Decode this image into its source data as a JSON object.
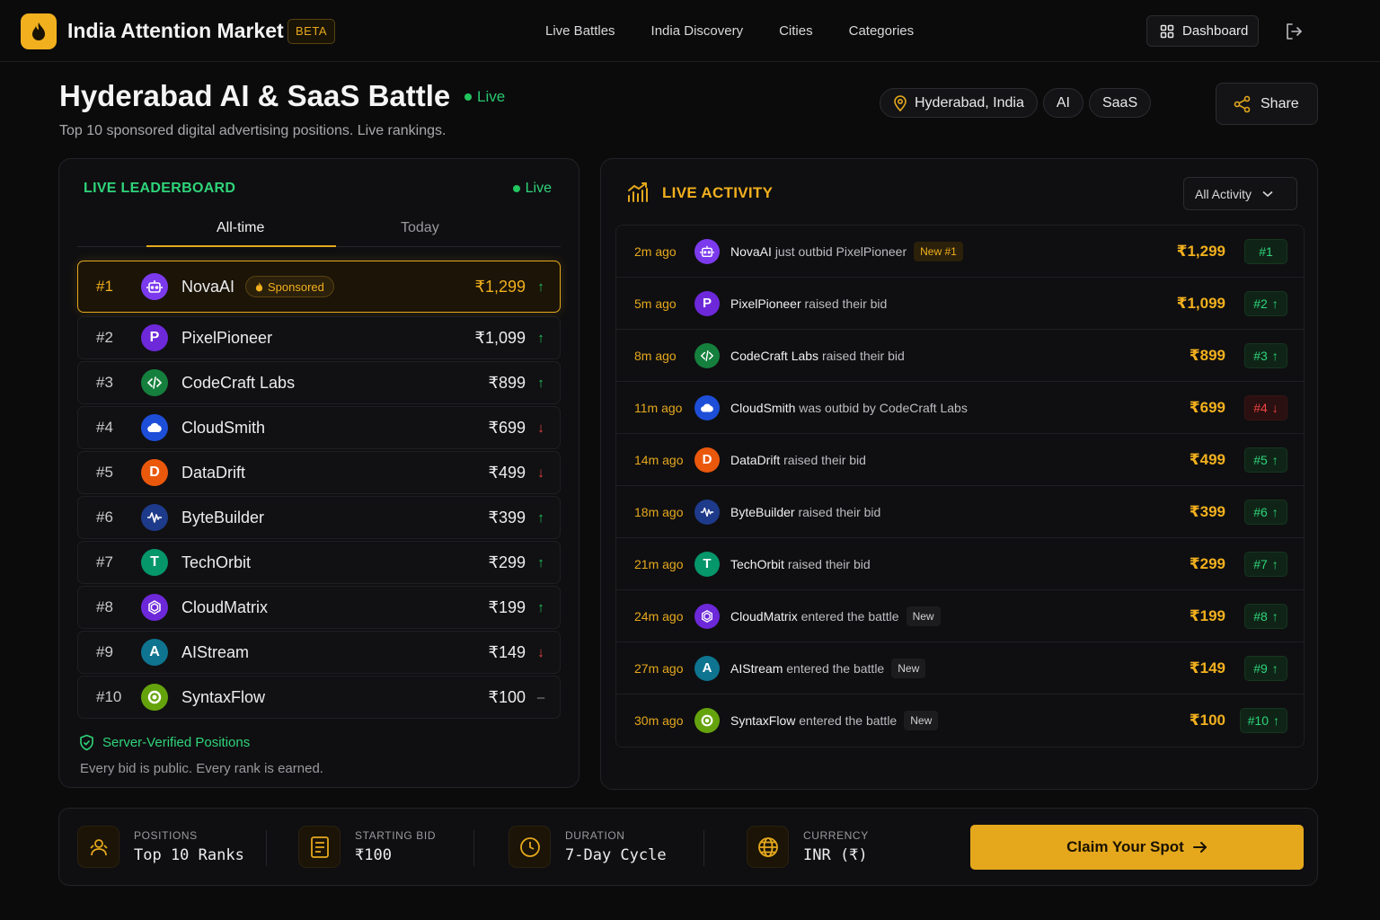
{
  "nav": {
    "brand": "India Attention Market",
    "beta_badge": "BETA",
    "links": [
      "Live Battles",
      "India Discovery",
      "Cities",
      "Categories"
    ],
    "dashboard_label": "Dashboard"
  },
  "header": {
    "title": "Hyderabad AI & SaaS Battle",
    "live_label": "Live",
    "subtitle": "Top 10 sponsored digital advertising positions. Live rankings.",
    "tags": [
      "Hyderabad, India",
      "AI",
      "SaaS"
    ],
    "share_label": "Share"
  },
  "leaderboard": {
    "title": "LIVE LEADERBOARD",
    "live_label": "Live",
    "tabs": [
      "All-time",
      "Today"
    ],
    "sponsored_label": "Sponsored",
    "rows": [
      {
        "rank": "#1",
        "name": "NovaAI",
        "bid": "₹1,299",
        "trend": "up",
        "initial": "",
        "color": "#7c3aed"
      },
      {
        "rank": "#2",
        "name": "PixelPioneer",
        "bid": "₹1,099",
        "trend": "up",
        "initial": "P",
        "color": "#6d28d9"
      },
      {
        "rank": "#3",
        "name": "CodeCraft Labs",
        "bid": "₹899",
        "trend": "up",
        "initial": "",
        "color": "#15803d"
      },
      {
        "rank": "#4",
        "name": "CloudSmith",
        "bid": "₹699",
        "trend": "down",
        "initial": "",
        "color": "#1d4ed8"
      },
      {
        "rank": "#5",
        "name": "DataDrift",
        "bid": "₹499",
        "trend": "down",
        "initial": "D",
        "color": "#ea580c"
      },
      {
        "rank": "#6",
        "name": "ByteBuilder",
        "bid": "₹399",
        "trend": "up",
        "initial": "",
        "color": "#1e3a8a"
      },
      {
        "rank": "#7",
        "name": "TechOrbit",
        "bid": "₹299",
        "trend": "up",
        "initial": "T",
        "color": "#059669"
      },
      {
        "rank": "#8",
        "name": "CloudMatrix",
        "bid": "₹199",
        "trend": "up",
        "initial": "",
        "color": "#6d28d9"
      },
      {
        "rank": "#9",
        "name": "AIStream",
        "bid": "₹149",
        "trend": "down",
        "initial": "A",
        "color": "#0e7490"
      },
      {
        "rank": "#10",
        "name": "SyntaxFlow",
        "bid": "₹100",
        "trend": "flat",
        "initial": "",
        "color": "#65a30d"
      }
    ],
    "verified_label": "Server-Verified Positions",
    "footnote": "Every bid is public. Every rank is earned."
  },
  "activity": {
    "title": "LIVE ACTIVITY",
    "filter_label": "All Activity",
    "rows": [
      {
        "time": "2m ago",
        "name": "NovaAI",
        "text": "just outbid PixelPioneer",
        "badge": "New #1",
        "badge_type": "new1",
        "amount": "₹1,299",
        "rank": "#1",
        "dir": "none",
        "color": "#7c3aed",
        "initial": ""
      },
      {
        "time": "5m ago",
        "name": "PixelPioneer",
        "text": "raised their bid",
        "badge": "",
        "badge_type": "",
        "amount": "₹1,099",
        "rank": "#2",
        "dir": "up",
        "color": "#6d28d9",
        "initial": "P"
      },
      {
        "time": "8m ago",
        "name": "CodeCraft Labs",
        "text": "raised their bid",
        "badge": "",
        "badge_type": "",
        "amount": "₹899",
        "rank": "#3",
        "dir": "up",
        "color": "#15803d",
        "initial": ""
      },
      {
        "time": "11m ago",
        "name": "CloudSmith",
        "text": "was outbid by CodeCraft Labs",
        "badge": "",
        "badge_type": "",
        "amount": "₹699",
        "rank": "#4",
        "dir": "down",
        "color": "#1d4ed8",
        "initial": ""
      },
      {
        "time": "14m ago",
        "name": "DataDrift",
        "text": "raised their bid",
        "badge": "",
        "badge_type": "",
        "amount": "₹499",
        "rank": "#5",
        "dir": "up",
        "color": "#ea580c",
        "initial": "D"
      },
      {
        "time": "18m ago",
        "name": "ByteBuilder",
        "text": "raised their bid",
        "badge": "",
        "badge_type": "",
        "amount": "₹399",
        "rank": "#6",
        "dir": "up",
        "color": "#1e3a8a",
        "initial": ""
      },
      {
        "time": "21m ago",
        "name": "TechOrbit",
        "text": "raised their bid",
        "badge": "",
        "badge_type": "",
        "amount": "₹299",
        "rank": "#7",
        "dir": "up",
        "color": "#059669",
        "initial": "T"
      },
      {
        "time": "24m ago",
        "name": "CloudMatrix",
        "text": "entered the battle",
        "badge": "New",
        "badge_type": "new",
        "amount": "₹199",
        "rank": "#8",
        "dir": "up",
        "color": "#6d28d9",
        "initial": ""
      },
      {
        "time": "27m ago",
        "name": "AIStream",
        "text": "entered the battle",
        "badge": "New",
        "badge_type": "new",
        "amount": "₹149",
        "rank": "#9",
        "dir": "up",
        "color": "#0e7490",
        "initial": "A"
      },
      {
        "time": "30m ago",
        "name": "SyntaxFlow",
        "text": "entered the battle",
        "badge": "New",
        "badge_type": "new",
        "amount": "₹100",
        "rank": "#10",
        "dir": "up",
        "color": "#65a30d",
        "initial": ""
      }
    ]
  },
  "stats": {
    "positions_label": "POSITIONS",
    "positions_value": "Top 10 Ranks",
    "starting_bid_label": "STARTING BID",
    "starting_bid_value": "₹100",
    "duration_label": "DURATION",
    "duration_value": "7-Day Cycle",
    "currency_label": "CURRENCY",
    "currency_value": "INR (₹)",
    "cta_label": "Claim Your Spot"
  },
  "colors": {
    "accent": "#e5a81d",
    "live_green": "#22c55e",
    "down_red": "#ef4444"
  }
}
